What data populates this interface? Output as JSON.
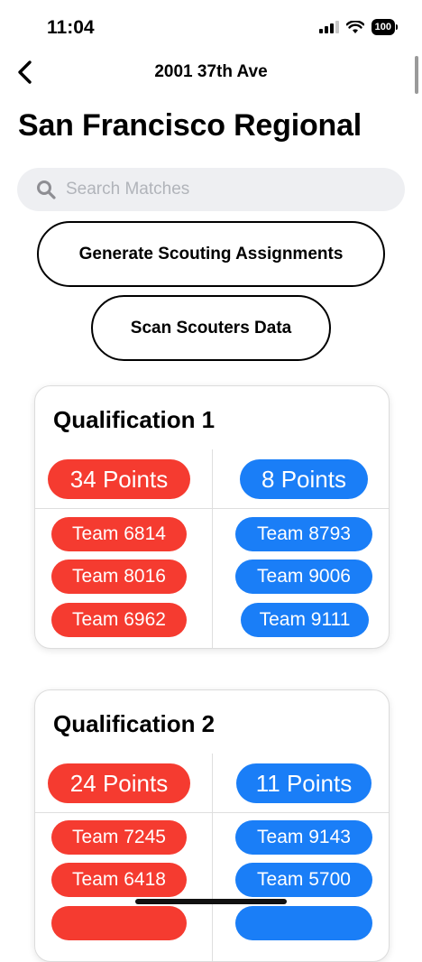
{
  "status_bar": {
    "time": "11:04",
    "battery": "100"
  },
  "nav": {
    "title": "2001 37th Ave"
  },
  "page_title": "San Francisco Regional",
  "search": {
    "placeholder": "Search Matches",
    "value": ""
  },
  "buttons": {
    "generate": "Generate Scouting Assignments",
    "scan": "Scan Scouters Data"
  },
  "matches": [
    {
      "title": "Qualification 1",
      "red": {
        "points": "34 Points",
        "teams": [
          "Team 6814",
          "Team 8016",
          "Team 6962"
        ]
      },
      "blue": {
        "points": "8 Points",
        "teams": [
          "Team 8793",
          "Team 9006",
          "Team 9111"
        ]
      }
    },
    {
      "title": "Qualification 2",
      "red": {
        "points": "24 Points",
        "teams": [
          "Team 7245",
          "Team 6418",
          ""
        ]
      },
      "blue": {
        "points": "11 Points",
        "teams": [
          "Team 9143",
          "Team 5700",
          ""
        ]
      }
    }
  ],
  "colors": {
    "red": "#f53b30",
    "blue": "#1a7ef7",
    "search_bg": "#eeeff2"
  },
  "icons": [
    "cellular-signal-icon",
    "wifi-icon",
    "battery-icon",
    "back-chevron-icon",
    "search-icon"
  ]
}
